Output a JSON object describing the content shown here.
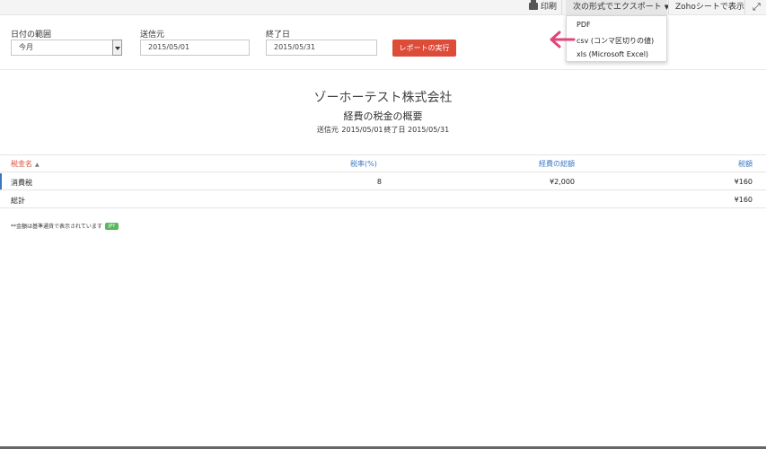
{
  "toolbar": {
    "print_label": "印刷",
    "export_label": "次の形式でエクスポート",
    "zoho_label": "Zohoシートで表示",
    "expand_icon": "expand-icon"
  },
  "export_menu": {
    "items": [
      "PDF",
      "csv (コンマ区切りの値)",
      "xls (Microsoft Excel)"
    ]
  },
  "filters": {
    "range_label": "日付の範囲",
    "range_value": "今月",
    "from_label": "送信元",
    "from_value": "2015/05/01",
    "to_label": "終了日",
    "to_value": "2015/05/31",
    "run_label": "レポートの実行"
  },
  "report": {
    "company": "ゾーホーテスト株式会社",
    "title": "経費の税金の概要",
    "period_from_label": "送信元",
    "period_from": "2015/05/01",
    "period_to_label": "終了日",
    "period_to": "2015/05/31"
  },
  "table": {
    "headers": [
      "税金名",
      "税率(%)",
      "経費の総額",
      "税額"
    ],
    "rows": [
      {
        "name": "消費税",
        "rate": "8",
        "total": "¥2,000",
        "tax": "¥160"
      }
    ],
    "total_row": {
      "name": "総計",
      "tax": "¥160"
    }
  },
  "footnote": {
    "text": "**金額は基準通貨で表示されています",
    "currency": "JPY"
  },
  "colors": {
    "accent_red": "#dd4b39",
    "link_blue": "#3b78c4",
    "badge_green": "#5cb85c",
    "arrow_pink": "#e0457b"
  }
}
